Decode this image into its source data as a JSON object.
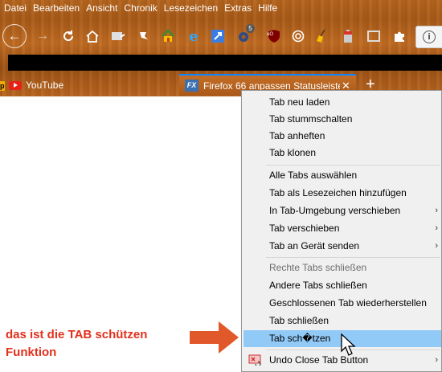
{
  "menubar": [
    "Datei",
    "Bearbeiten",
    "Ansicht",
    "Chronik",
    "Lesezeichen",
    "Extras",
    "Hilfe"
  ],
  "toolbar": {
    "badge_5": "5",
    "badge_uo": "uO",
    "info": "i"
  },
  "tabs": {
    "tab1_fragment": "p",
    "tab1_label": "YouTube",
    "tab2_icon": "FX",
    "tab2_label": "Firefox 66 anpassen Statusleiste",
    "tab2_close": "✕",
    "new_tab": "+"
  },
  "context_menu": {
    "group1": [
      "Tab neu laden",
      "Tab stummschalten",
      "Tab anheften",
      "Tab klonen"
    ],
    "group2": [
      {
        "label": "Alle Tabs auswählen",
        "submenu": false
      },
      {
        "label": "Tab als Lesezeichen hinzufügen",
        "submenu": false
      },
      {
        "label": "In Tab-Umgebung verschieben",
        "submenu": true
      },
      {
        "label": "Tab verschieben",
        "submenu": true
      },
      {
        "label": "Tab an Gerät senden",
        "submenu": true
      }
    ],
    "group3": [
      {
        "label": "Rechte Tabs schließen",
        "disabled": true
      },
      {
        "label": "Andere Tabs schließen",
        "disabled": false
      },
      {
        "label": "Geschlossenen Tab wiederherstellen",
        "disabled": false
      },
      {
        "label": "Tab schließen",
        "disabled": false
      },
      {
        "label": "Tab sch�tzen",
        "disabled": false,
        "active": true
      }
    ],
    "group4": [
      {
        "label": "Undo Close Tab Button",
        "submenu": true,
        "icon": "undo-close-tab-icon"
      }
    ],
    "submenu_arrow": "›"
  },
  "annotation": {
    "line1": "das ist die TAB schützen",
    "line2": "Funktion"
  },
  "colors": {
    "highlight": "#91c9f7",
    "annotation": "#e3301c",
    "wood": "#b5651d",
    "tab_active_border": "#0a84ff"
  }
}
